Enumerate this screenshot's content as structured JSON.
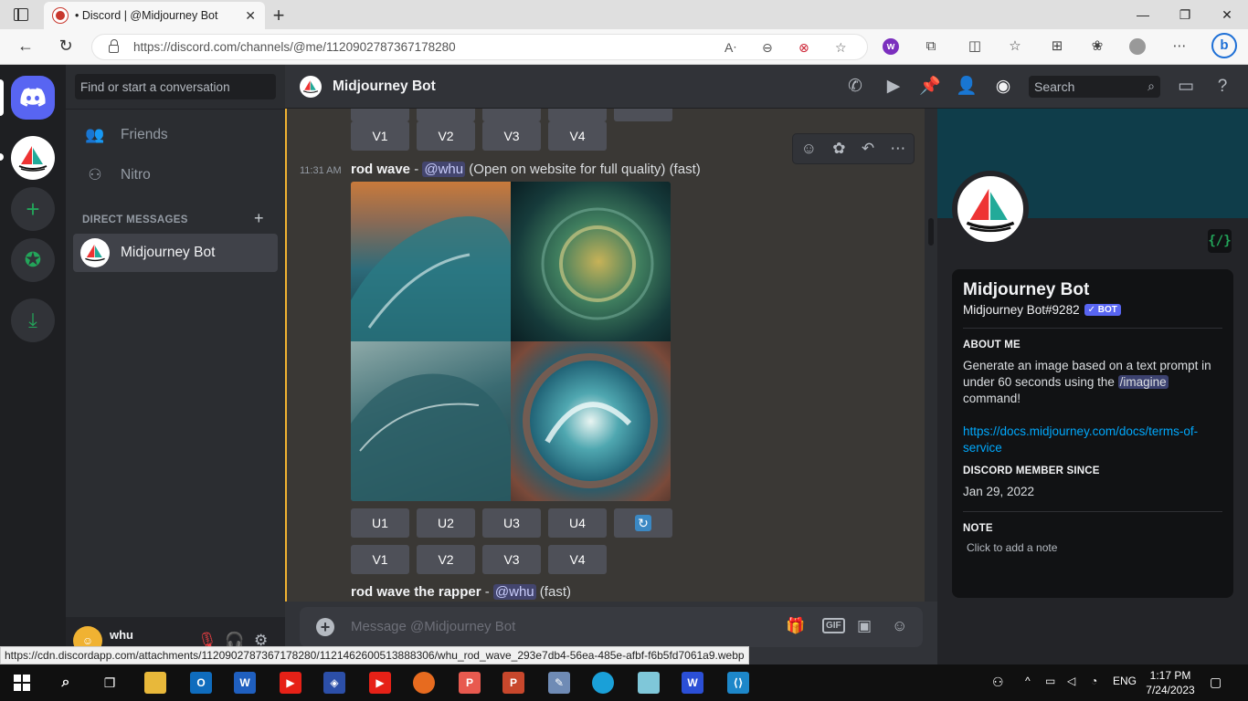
{
  "browser": {
    "tab_title": "• Discord | @Midjourney Bot",
    "url": "https://discord.com/channels/@me/1120902787367178280",
    "status_url": "https://cdn.discordapp.com/attachments/1120902787367178280/1121462600513888306/whu_rod_wave_293e7db4-56ea-485e-afbf-f6b5fd7061a9.webp"
  },
  "dm_sidebar": {
    "search_placeholder": "Find or start a conversation",
    "friends_label": "Friends",
    "nitro_label": "Nitro",
    "section_label": "DIRECT MESSAGES",
    "selected_dm": "Midjourney Bot",
    "user_name": "whu"
  },
  "header": {
    "channel_name": "Midjourney Bot",
    "search_placeholder": "Search"
  },
  "messages": {
    "top_buttons": [
      "V1",
      "V2",
      "V3",
      "V4"
    ],
    "msg1": {
      "time": "11:31 AM",
      "prompt": "rod wave",
      "sep": " - ",
      "mention": "@whu",
      "suffix": " (Open on website for full quality) (fast)"
    },
    "upscale_buttons": [
      "U1",
      "U2",
      "U3",
      "U4"
    ],
    "variation_buttons": [
      "V1",
      "V2",
      "V3",
      "V4"
    ],
    "msg2": {
      "prompt": "rod wave the rapper",
      "sep": " - ",
      "mention": "@whu",
      "suffix": " (fast)"
    }
  },
  "composer": {
    "placeholder": "Message @Midjourney Bot",
    "gif_label": "GIF"
  },
  "profile": {
    "name": "Midjourney Bot",
    "tag": "Midjourney Bot#9282",
    "badge": "✓ BOT",
    "about_label": "ABOUT ME",
    "about_text_1": "Generate an image based on a text prompt in under 60 seconds using the ",
    "about_cmd": "/imagine",
    "about_text_2": " command!",
    "link": "https://docs.midjourney.com/docs/terms-of-service",
    "member_since_label": "DISCORD MEMBER SINCE",
    "member_since": "Jan 29, 2022",
    "note_label": "NOTE",
    "note_placeholder": "Click to add a note"
  },
  "taskbar": {
    "language": "ENG",
    "time": "1:17 PM",
    "date": "7/24/2023"
  },
  "colors": {
    "accent": "#5865f2",
    "highlight_bar": "#f0b232",
    "link": "#00a8fc"
  }
}
